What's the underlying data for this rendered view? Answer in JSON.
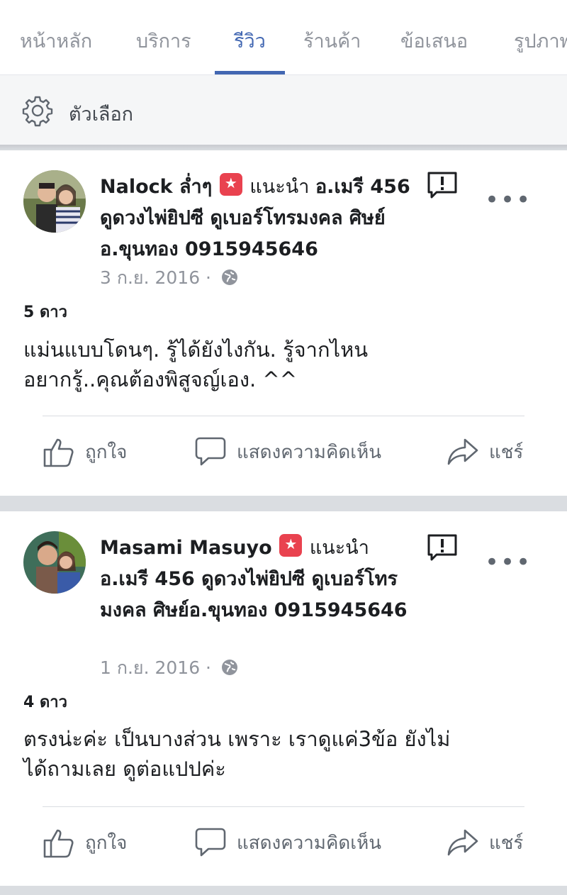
{
  "tabs": [
    {
      "label": "หน้าหลัก",
      "active": false
    },
    {
      "label": "บริการ",
      "active": false
    },
    {
      "label": "รีวิว",
      "active": true
    },
    {
      "label": "ร้านค้า",
      "active": false
    },
    {
      "label": "ข้อเสนอ",
      "active": false
    },
    {
      "label": "รูปภาพ",
      "active": false
    }
  ],
  "options": {
    "label": "ตัวเลือก",
    "icon": "gear-icon"
  },
  "posts": [
    {
      "author": "Nalock ล่ำๆ",
      "recommends": "แนะนำ",
      "page_name": "อ.เมรี 456 ดูดวงไพ่ยิปซี ดูเบอร์โทรมงคล ศิษย์อ.ขุนทอง 0915945646",
      "date": "3 ก.ย. 2016 ·",
      "rating": "5 ดาว",
      "text_lines": [
        "แม่นแบบโดนๆ. รู้ได้ยังไงกัน. รู้จากไหน",
        "อยากรู้..คุณต้องพิสูจญ์เอง.  ^^"
      ]
    },
    {
      "author": "Masami Masuyo",
      "recommends": "แนะนำ",
      "page_name": "อ.เมรี 456 ดูดวงไพ่ยิปซี ดูเบอร์โทรมงคล ศิษย์อ.ขุนทอง 0915945646",
      "date": "1 ก.ย. 2016 ·",
      "rating": "4 ดาว",
      "text_lines": [
        "ตรงน่ะค่ะ  เป็นบางส่วน  เพราะ เราดูแค่3ข้อ ยังไม่",
        "ได้ถามเลย ดูต่อแปปค่ะ"
      ]
    }
  ],
  "actions": {
    "like": "ถูกใจ",
    "comment": "แสดงความคิดเห็น",
    "share": "แชร์"
  },
  "colors": {
    "accent": "#4267b2",
    "badge": "#e9424f",
    "muted": "#606770"
  }
}
